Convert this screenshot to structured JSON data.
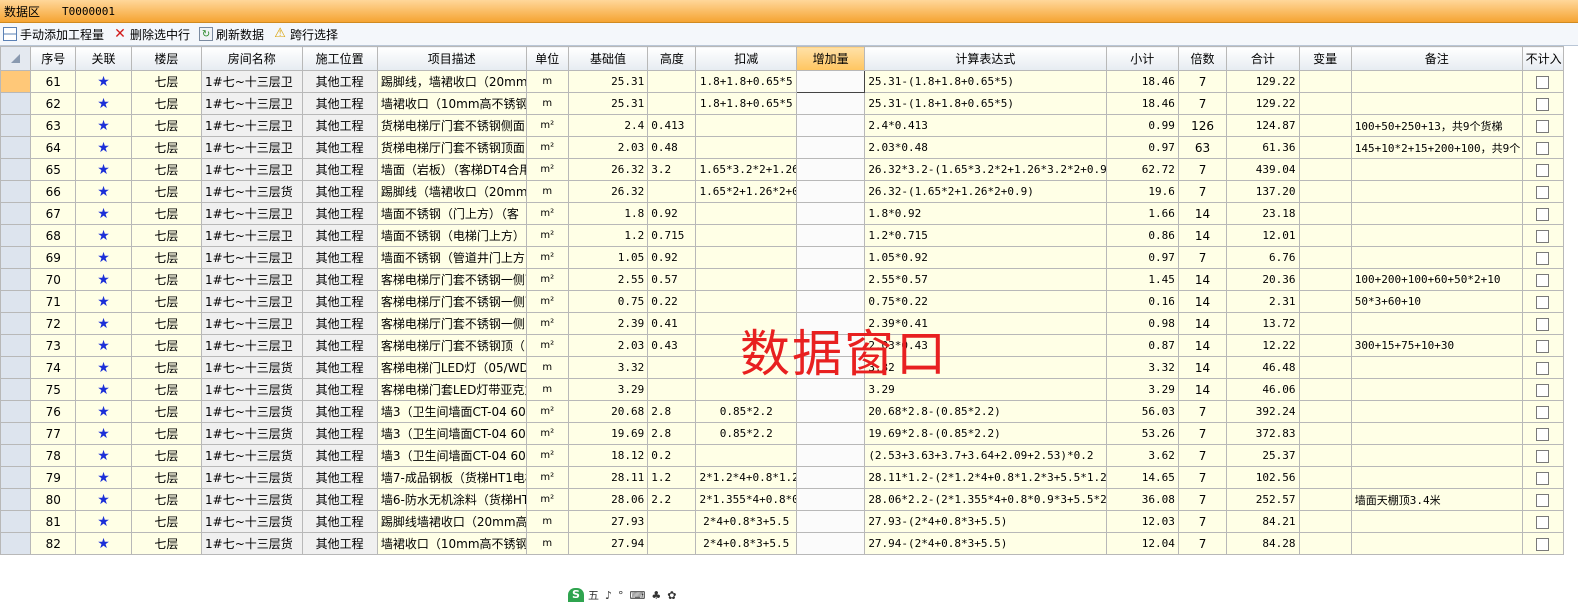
{
  "titlebar": {
    "title": "数据区",
    "code": "T0000001"
  },
  "toolbar": {
    "add_label": "手动添加工程量",
    "delete_label": "删除选中行",
    "refresh_label": "刷新数据",
    "cross_label": "跨行选择"
  },
  "columns": [
    "序号",
    "关联",
    "楼层",
    "房间名称",
    "施工位置",
    "项目描述",
    "单位",
    "基础值",
    "高度",
    "扣减",
    "增加量",
    "计算表达式",
    "小计",
    "倍数",
    "合计",
    "变量",
    "备注",
    "不计入"
  ],
  "star": "★",
  "rows": [
    {
      "seq": "61",
      "floor": "七层",
      "room": "1#七~十三层卫",
      "pos": "其他工程",
      "desc": "踢脚线，墙裙收口（20mm高不",
      "unit": "m",
      "base": "25.31",
      "height": "",
      "deduct": "1.8+1.8+0.65*5",
      "add": "",
      "expr": "25.31-(1.8+1.8+0.65*5)",
      "subtotal": "18.46",
      "mult": "7",
      "total": "129.22",
      "var": "",
      "note": ""
    },
    {
      "seq": "62",
      "floor": "七层",
      "room": "1#七~十三层卫",
      "pos": "其他工程",
      "desc": "墙裙收口（10mm高不锈钢）3",
      "unit": "m",
      "base": "25.31",
      "height": "",
      "deduct": "1.8+1.8+0.65*5",
      "add": "",
      "expr": "25.31-(1.8+1.8+0.65*5)",
      "subtotal": "18.46",
      "mult": "7",
      "total": "129.22",
      "var": "",
      "note": ""
    },
    {
      "seq": "63",
      "floor": "七层",
      "room": "1#七~十三层卫",
      "pos": "其他工程",
      "desc": "货梯电梯厅门套不锈钢侧面",
      "unit": "m²",
      "base": "2.4",
      "height": "0.413",
      "deduct": "",
      "add": "",
      "expr": "2.4*0.413",
      "subtotal": "0.99",
      "mult": "126",
      "total": "124.87",
      "var": "",
      "note": "100+50+250+13，共9个货梯"
    },
    {
      "seq": "64",
      "floor": "七层",
      "room": "1#七~十三层卫",
      "pos": "其他工程",
      "desc": "货梯电梯厅门套不锈钢顶面",
      "unit": "m²",
      "base": "2.03",
      "height": "0.48",
      "deduct": "",
      "add": "",
      "expr": "2.03*0.48",
      "subtotal": "0.97",
      "mult": "63",
      "total": "61.36",
      "var": "",
      "note": "145+10*2+15+200+100，共9个"
    },
    {
      "seq": "65",
      "floor": "七层",
      "room": "1#七~十三层卫",
      "pos": "其他工程",
      "desc": "墙面（岩板）（客梯DT4合用",
      "unit": "m²",
      "base": "26.32",
      "height": "3.2",
      "deduct": "1.65*3.2*2+1.26",
      "add": "",
      "expr": "26.32*3.2-(1.65*3.2*2+1.26*3.2*2+0.9*3.",
      "subtotal": "62.72",
      "mult": "7",
      "total": "439.04",
      "var": "",
      "note": ""
    },
    {
      "seq": "66",
      "floor": "七层",
      "room": "1#七~十三层货",
      "pos": "其他工程",
      "desc": "踢脚线（墙裙收口（20mm高不",
      "unit": "m",
      "base": "26.32",
      "height": "",
      "deduct": "1.65*2+1.26*2+0",
      "add": "",
      "expr": "26.32-(1.65*2+1.26*2+0.9)",
      "subtotal": "19.6",
      "mult": "7",
      "total": "137.20",
      "var": "",
      "note": ""
    },
    {
      "seq": "67",
      "floor": "七层",
      "room": "1#七~十三层卫",
      "pos": "其他工程",
      "desc": "墙面不锈钢（门上方）（客",
      "unit": "m²",
      "base": "1.8",
      "height": "0.92",
      "deduct": "",
      "add": "",
      "expr": "1.8*0.92",
      "subtotal": "1.66",
      "mult": "14",
      "total": "23.18",
      "var": "",
      "note": ""
    },
    {
      "seq": "68",
      "floor": "七层",
      "room": "1#七~十三层卫",
      "pos": "其他工程",
      "desc": "墙面不锈钢（电梯门上方）（",
      "unit": "m²",
      "base": "1.2",
      "height": "0.715",
      "deduct": "",
      "add": "",
      "expr": "1.2*0.715",
      "subtotal": "0.86",
      "mult": "14",
      "total": "12.01",
      "var": "",
      "note": ""
    },
    {
      "seq": "69",
      "floor": "七层",
      "room": "1#七~十三层卫",
      "pos": "其他工程",
      "desc": "墙面不锈钢（管道井门上方",
      "unit": "m²",
      "base": "1.05",
      "height": "0.92",
      "deduct": "",
      "add": "",
      "expr": "1.05*0.92",
      "subtotal": "0.97",
      "mult": "7",
      "total": "6.76",
      "var": "",
      "note": ""
    },
    {
      "seq": "70",
      "floor": "七层",
      "room": "1#七~十三层卫",
      "pos": "其他工程",
      "desc": "客梯电梯厅门套不锈钢一侧面",
      "unit": "m²",
      "base": "2.55",
      "height": "0.57",
      "deduct": "",
      "add": "",
      "expr": "2.55*0.57",
      "subtotal": "1.45",
      "mult": "14",
      "total": "20.36",
      "var": "",
      "note": "100+200+100+60+50*2+10"
    },
    {
      "seq": "71",
      "floor": "七层",
      "room": "1#七~十三层卫",
      "pos": "其他工程",
      "desc": "客梯电梯厅门套不锈钢一侧面",
      "unit": "m²",
      "base": "0.75",
      "height": "0.22",
      "deduct": "",
      "add": "",
      "expr": "0.75*0.22",
      "subtotal": "0.16",
      "mult": "14",
      "total": "2.31",
      "var": "",
      "note": "50*3+60+10"
    },
    {
      "seq": "72",
      "floor": "七层",
      "room": "1#七~十三层卫",
      "pos": "其他工程",
      "desc": "客梯电梯厅门套不锈钢一侧",
      "unit": "m²",
      "base": "2.39",
      "height": "0.41",
      "deduct": "",
      "add": "",
      "expr": "2.39*0.41",
      "subtotal": "0.98",
      "mult": "14",
      "total": "13.72",
      "var": "",
      "note": ""
    },
    {
      "seq": "73",
      "floor": "七层",
      "room": "1#七~十三层卫",
      "pos": "其他工程",
      "desc": "客梯电梯厅门套不锈钢顶（",
      "unit": "m²",
      "base": "2.03",
      "height": "0.43",
      "deduct": "",
      "add": "",
      "expr": "2.03*0.43",
      "subtotal": "0.87",
      "mult": "14",
      "total": "12.22",
      "var": "",
      "note": "300+15+75+10+30"
    },
    {
      "seq": "74",
      "floor": "七层",
      "room": "1#七~十三层货",
      "pos": "其他工程",
      "desc": "客梯电梯门LED灯（05/WD-0",
      "unit": "m",
      "base": "3.32",
      "height": "",
      "deduct": "",
      "add": "",
      "expr": "3.32",
      "subtotal": "3.32",
      "mult": "14",
      "total": "46.48",
      "var": "",
      "note": ""
    },
    {
      "seq": "75",
      "floor": "七层",
      "room": "1#七~十三层货",
      "pos": "其他工程",
      "desc": "客梯电梯门套LED灯带亚克力",
      "unit": "m",
      "base": "3.29",
      "height": "",
      "deduct": "",
      "add": "",
      "expr": "3.29",
      "subtotal": "3.29",
      "mult": "14",
      "total": "46.06",
      "var": "",
      "note": ""
    },
    {
      "seq": "76",
      "floor": "七层",
      "room": "1#七~十三层货",
      "pos": "其他工程",
      "desc": "墙3（卫生间墙面CT-04 600×",
      "unit": "m²",
      "base": "20.68",
      "height": "2.8",
      "deduct": "0.85*2.2",
      "add": "",
      "expr": "20.68*2.8-(0.85*2.2)",
      "subtotal": "56.03",
      "mult": "7",
      "total": "392.24",
      "var": "",
      "note": ""
    },
    {
      "seq": "77",
      "floor": "七层",
      "room": "1#七~十三层货",
      "pos": "其他工程",
      "desc": "墙3（卫生间墙面CT-04 600×",
      "unit": "m²",
      "base": "19.69",
      "height": "2.8",
      "deduct": "0.85*2.2",
      "add": "",
      "expr": "19.69*2.8-(0.85*2.2)",
      "subtotal": "53.26",
      "mult": "7",
      "total": "372.83",
      "var": "",
      "note": ""
    },
    {
      "seq": "78",
      "floor": "七层",
      "room": "1#七~十三层货",
      "pos": "其他工程",
      "desc": "墙3（卫生间墙面CT-04 600×",
      "unit": "m²",
      "base": "18.12",
      "height": "0.2",
      "deduct": "",
      "add": "",
      "expr": "(2.53+3.63+3.7+3.64+2.09+2.53)*0.2",
      "subtotal": "3.62",
      "mult": "7",
      "total": "25.37",
      "var": "",
      "note": ""
    },
    {
      "seq": "79",
      "floor": "七层",
      "room": "1#七~十三层货",
      "pos": "其他工程",
      "desc": "墙7-成品钢板（货梯HT1电梯",
      "unit": "m²",
      "base": "28.11",
      "height": "1.2",
      "deduct": "2*1.2*4+0.8*1.2",
      "add": "",
      "expr": "28.11*1.2-(2*1.2*4+0.8*1.2*3+5.5*1.2)",
      "subtotal": "14.65",
      "mult": "7",
      "total": "102.56",
      "var": "",
      "note": ""
    },
    {
      "seq": "80",
      "floor": "七层",
      "room": "1#七~十三层货",
      "pos": "其他工程",
      "desc": "墙6-防水无机涂料（货梯HT1",
      "unit": "m²",
      "base": "28.06",
      "height": "2.2",
      "deduct": "2*1.355*4+0.8*0",
      "add": "",
      "expr": "28.06*2.2-(2*1.355*4+0.8*0.9*3+5.5*2.3)",
      "subtotal": "36.08",
      "mult": "7",
      "total": "252.57",
      "var": "",
      "note": "墙面天棚顶3.4米"
    },
    {
      "seq": "81",
      "floor": "七层",
      "room": "1#七~十三层货",
      "pos": "其他工程",
      "desc": "踢脚线墙裙收口（20mm高不锈",
      "unit": "m",
      "base": "27.93",
      "height": "",
      "deduct": "2*4+0.8*3+5.5",
      "add": "",
      "expr": "27.93-(2*4+0.8*3+5.5)",
      "subtotal": "12.03",
      "mult": "7",
      "total": "84.21",
      "var": "",
      "note": ""
    },
    {
      "seq": "82",
      "floor": "七层",
      "room": "1#七~十三层货",
      "pos": "其他工程",
      "desc": "墙裙收口（10mm高不锈钢）×",
      "unit": "m",
      "base": "27.94",
      "height": "",
      "deduct": "2*4+0.8*3+5.5",
      "add": "",
      "expr": "27.94-(2*4+0.8*3+5.5)",
      "subtotal": "12.04",
      "mult": "7",
      "total": "84.28",
      "var": "",
      "note": ""
    }
  ],
  "watermark": "数据窗口",
  "ime": {
    "logo": "S",
    "mode": "五",
    "items": [
      "♪",
      "°",
      "⌨",
      "♣",
      "✿"
    ]
  }
}
